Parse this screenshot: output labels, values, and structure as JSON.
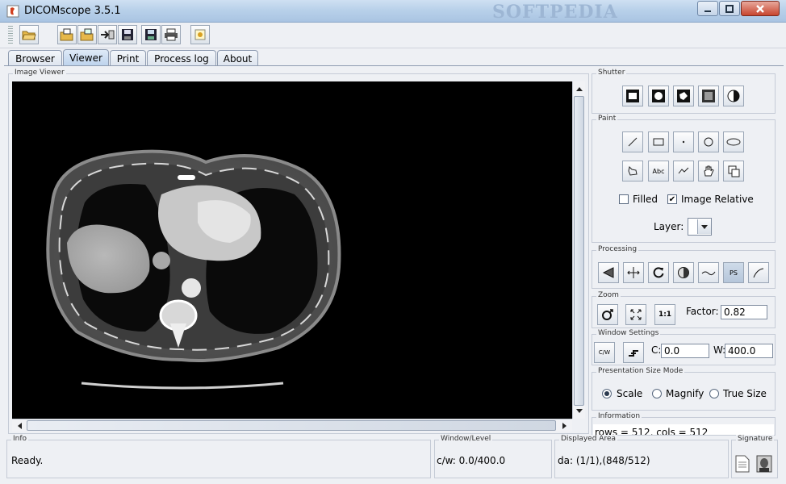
{
  "window": {
    "title": "DICOMscope 3.5.1",
    "watermark": "SOFTPEDIA"
  },
  "toolbar": {
    "buttons": [
      "open-folder-icon",
      "open-dicom-icon",
      "open-pr-icon",
      "send-icon",
      "save-icon",
      "save-as-icon",
      "print-icon",
      "settings-icon"
    ]
  },
  "tabs": [
    {
      "label": "Browser"
    },
    {
      "label": "Viewer"
    },
    {
      "label": "Print"
    },
    {
      "label": "Process log"
    },
    {
      "label": "About"
    }
  ],
  "image_viewer": {
    "title": "Image Viewer"
  },
  "shutter": {
    "title": "Shutter"
  },
  "paint": {
    "title": "Paint",
    "filled_label": "Filled",
    "filled_checked": false,
    "image_relative_label": "Image Relative",
    "image_relative_checked": true,
    "layer_label": "Layer:"
  },
  "processing": {
    "title": "Processing",
    "ps_label": "PS"
  },
  "zoom": {
    "title": "Zoom",
    "factor_label": "Factor:",
    "factor_value": "0.82",
    "one_to_one": "1:1"
  },
  "window_settings": {
    "title": "Window Settings",
    "c_label": "C:",
    "c_value": "0.0",
    "w_label": "W:",
    "w_value": "400.0",
    "cw_icon_text": "C/W"
  },
  "presentation": {
    "title": "Presentation Size Mode",
    "options": [
      "Scale",
      "Magnify",
      "True Size"
    ],
    "selected": "Scale"
  },
  "information": {
    "title": "Information",
    "text": "rows = 512, cols = 512"
  },
  "statusbar": {
    "info_title": "Info",
    "info_text": "Ready.",
    "wl_title": "Window/Level",
    "wl_text": "c/w: 0.0/400.0",
    "da_title": "Displayed Area",
    "da_text": "da: (1/1),(848/512)",
    "sig_title": "Signature"
  },
  "softpedia_url": "www.softpedia.com"
}
